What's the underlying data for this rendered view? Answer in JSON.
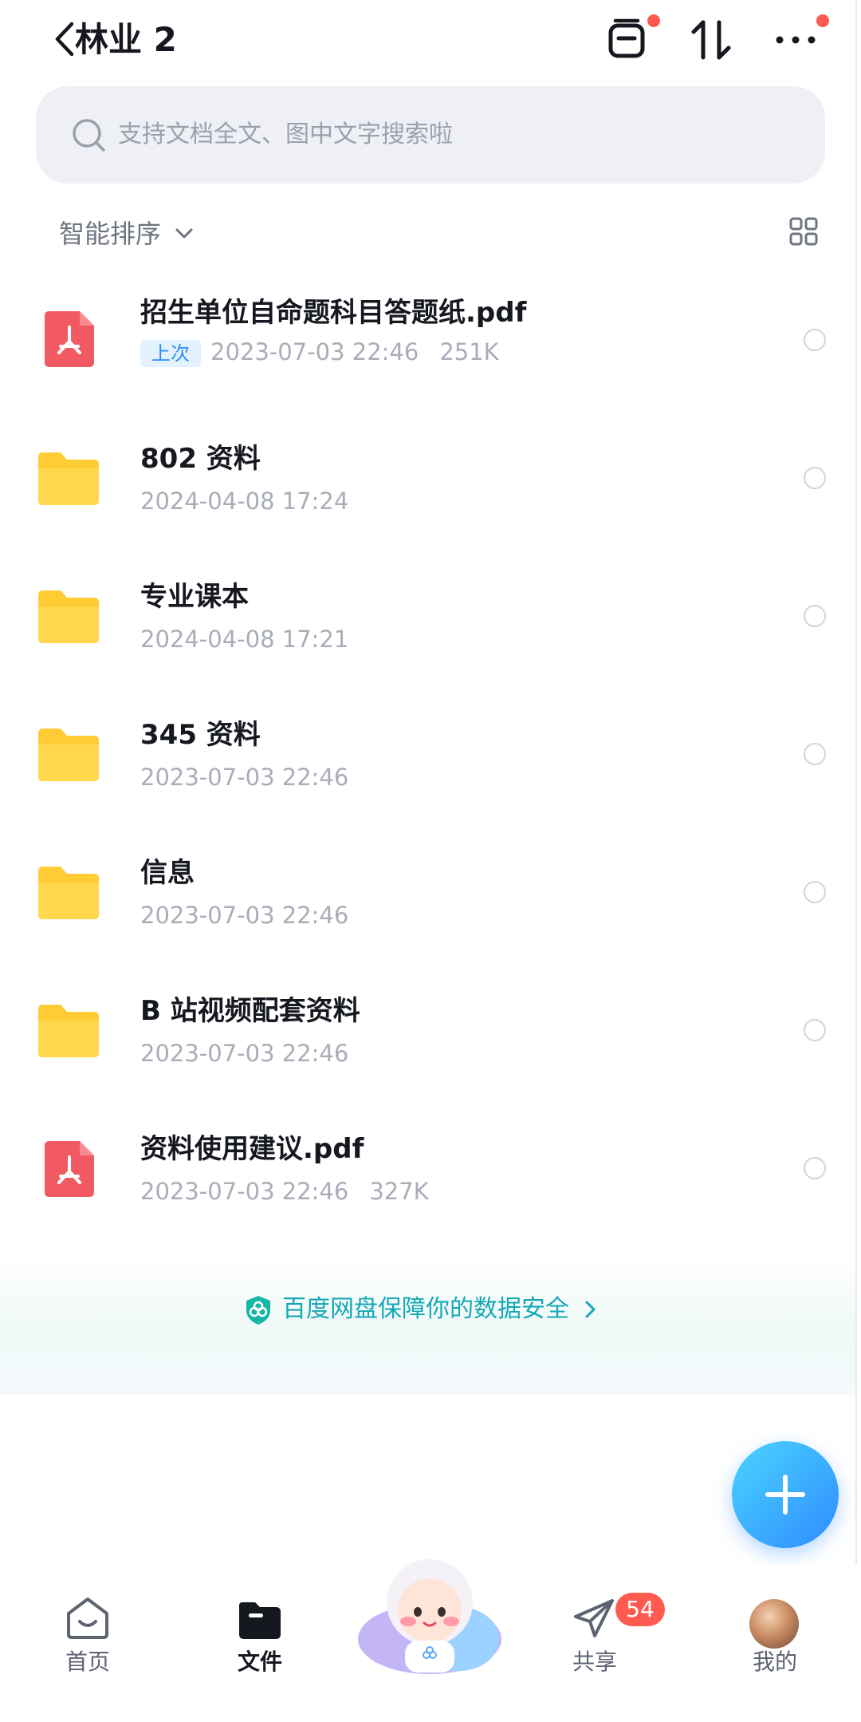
{
  "header": {
    "title": "林业 2",
    "icons": [
      "back-icon",
      "transfer-list-icon",
      "sort-arrows-icon",
      "more-icon"
    ]
  },
  "search": {
    "placeholder": "支持文档全文、图中文字搜索啦"
  },
  "sort": {
    "label": "智能排序"
  },
  "files": [
    {
      "type": "pdf",
      "name": "招生单位自命题科目答题纸.pdf",
      "tag": "上次",
      "date": "2023-07-03 22:46",
      "size": "251K"
    },
    {
      "type": "folder",
      "name": "802 资料",
      "date": "2024-04-08 17:24"
    },
    {
      "type": "folder",
      "name": "专业课本",
      "date": "2024-04-08 17:21"
    },
    {
      "type": "folder",
      "name": "345 资料",
      "date": "2023-07-03 22:46"
    },
    {
      "type": "folder",
      "name": "信息",
      "date": "2023-07-03 22:46"
    },
    {
      "type": "folder",
      "name": "B 站视频配套资料",
      "date": "2023-07-03 22:46"
    },
    {
      "type": "pdf",
      "name": "资料使用建议.pdf",
      "date": "2023-07-03 22:46",
      "size": "327K"
    }
  ],
  "banner": {
    "text": "百度网盘保障你的数据安全"
  },
  "nav": {
    "home": "首页",
    "files": "文件",
    "share": "共享",
    "share_badge": "54",
    "mine": "我的"
  },
  "colors": {
    "accent": "#2f8cff",
    "badge": "#ff5a4f",
    "folder": "#ffcc33",
    "pdf": "#f25a63",
    "banner_text": "#13a8b6"
  }
}
